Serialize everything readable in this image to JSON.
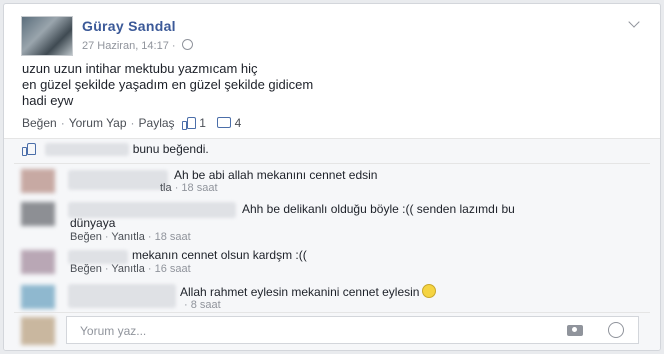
{
  "post": {
    "author": "Güray Sandal",
    "timestamp": "27 Haziran, 14:17",
    "separator": "·",
    "lines": [
      "uzun uzun intihar mektubu yazmıcam hiç",
      "en güzel şekilde yaşadım en güzel şekilde gidicem",
      "hadi eyw"
    ]
  },
  "actions": {
    "like": "Beğen",
    "comment": "Yorum Yap",
    "share": "Paylaş",
    "like_count": "1",
    "comment_count": "4"
  },
  "likes_summary": "bunu beğendi.",
  "comments": [
    {
      "text": "Ah be abi allah mekanını cennet edsin",
      "reply": "tla",
      "time": "18 saat"
    },
    {
      "text": "Ahh be delikanlı olduğu böyle :(( senden lazımdı bu",
      "text2": "dünyaya",
      "like": "Beğen",
      "reply": "Yanıtla",
      "time": "18 saat"
    },
    {
      "text": "mekanın cennet olsun kardşm :((",
      "like": "Beğen",
      "reply": "Yanıtla",
      "time": "16 saat"
    },
    {
      "text": "Allah rahmet eylesin mekanini cennet eylesin",
      "time": "8 saat"
    }
  ],
  "composer": {
    "placeholder": "Yorum yaz..."
  },
  "icons": [
    "globe-icon",
    "chevron-down-icon",
    "like-icon",
    "comment-icon",
    "camera-icon",
    "sticker-icon",
    "smile-emoji-icon"
  ]
}
